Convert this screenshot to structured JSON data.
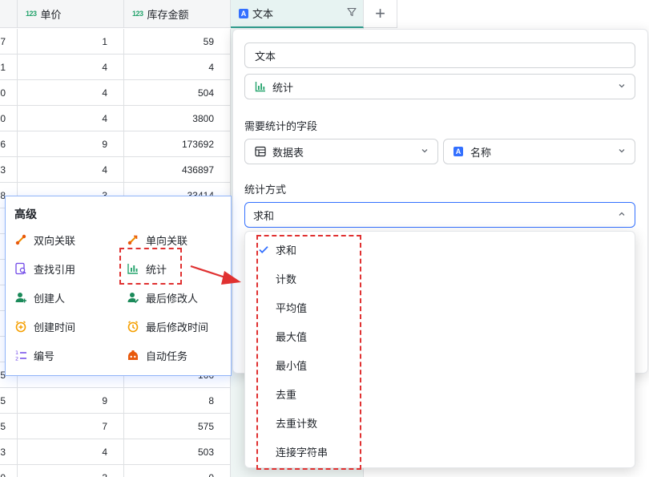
{
  "grid": {
    "columns": [
      {
        "label": "单价",
        "icon": "number-field-icon"
      },
      {
        "label": "库存金额",
        "icon": "number-field-icon"
      },
      {
        "label": "文本",
        "icon": "text-field-icon"
      }
    ],
    "number_icon_text": "123",
    "text_icon_text": "A",
    "add_column_label": "+",
    "rows": [
      {
        "left": "7",
        "price": "1",
        "stock": "59"
      },
      {
        "left": "1",
        "price": "4",
        "stock": "4"
      },
      {
        "left": "0",
        "price": "4",
        "stock": "504"
      },
      {
        "left": "0",
        "price": "4",
        "stock": "3800"
      },
      {
        "left": "6",
        "price": "9",
        "stock": "173692"
      },
      {
        "left": "3",
        "price": "4",
        "stock": "436897"
      },
      {
        "left": "8",
        "price": "3",
        "stock": "33414"
      },
      {
        "left": "",
        "price": "",
        "stock": ""
      },
      {
        "left": "",
        "price": "",
        "stock": ""
      },
      {
        "left": "",
        "price": "",
        "stock": ""
      },
      {
        "left": "",
        "price": "",
        "stock": ""
      },
      {
        "left": "",
        "price": "",
        "stock": ""
      },
      {
        "left": "",
        "price": "",
        "stock": ""
      },
      {
        "left": "5",
        "price": "",
        "stock": "166"
      },
      {
        "left": "5",
        "price": "9",
        "stock": "8"
      },
      {
        "left": "5",
        "price": "7",
        "stock": "575"
      },
      {
        "left": "3",
        "price": "4",
        "stock": "503"
      },
      {
        "left": "0",
        "price": "3",
        "stock": "0"
      }
    ]
  },
  "panel": {
    "field_name": "文本",
    "field_type": "统计",
    "stat_field_label": "需要统计的字段",
    "table_select": "数据表",
    "field_select": "名称",
    "method_label": "统计方式",
    "method_value": "求和"
  },
  "dropdown": {
    "options": [
      "求和",
      "计数",
      "平均值",
      "最大值",
      "最小值",
      "去重",
      "去重计数",
      "连接字符串"
    ],
    "selected_index": 0
  },
  "advanced": {
    "title": "高级",
    "items": [
      {
        "label": "双向关联",
        "icon": "two-way-link-icon"
      },
      {
        "label": "单向关联",
        "icon": "one-way-link-icon"
      },
      {
        "label": "查找引用",
        "icon": "lookup-icon"
      },
      {
        "label": "统计",
        "icon": "statistics-icon"
      },
      {
        "label": "创建人",
        "icon": "creator-icon"
      },
      {
        "label": "最后修改人",
        "icon": "last-modifier-icon"
      },
      {
        "label": "创建时间",
        "icon": "created-time-icon"
      },
      {
        "label": "最后修改时间",
        "icon": "modified-time-icon"
      },
      {
        "label": "编号",
        "icon": "auto-number-icon"
      },
      {
        "label": "自动任务",
        "icon": "automation-icon"
      }
    ]
  },
  "colors": {
    "accent": "#3370ff",
    "stat_green": "#24a36c",
    "annotation_red": "#e03131"
  }
}
